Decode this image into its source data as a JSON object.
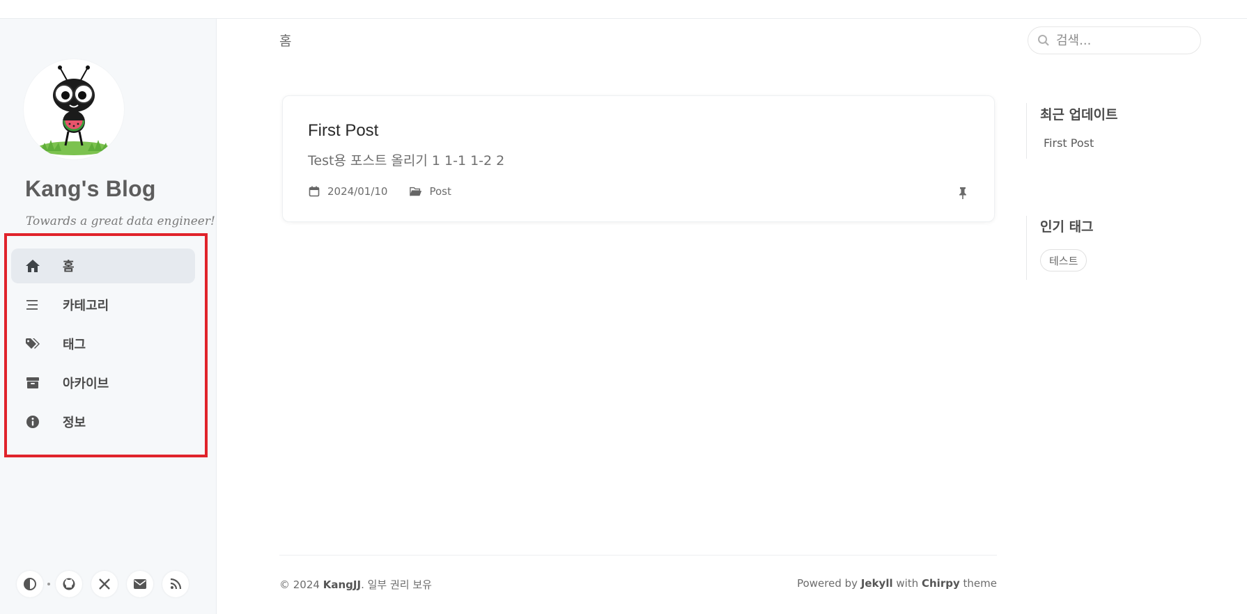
{
  "sidebar": {
    "site_title": "Kang's Blog",
    "site_subtitle": "Towards a great data engineer!",
    "nav": [
      {
        "label": "홈",
        "icon": "home-icon",
        "active": true
      },
      {
        "label": "카테고리",
        "icon": "stream-icon",
        "active": false
      },
      {
        "label": "태그",
        "icon": "tags-icon",
        "active": false
      },
      {
        "label": "아카이브",
        "icon": "archive-icon",
        "active": false
      },
      {
        "label": "정보",
        "icon": "info-circle-icon",
        "active": false
      }
    ],
    "bottom_icons": [
      "theme-toggle-icon",
      "github-icon",
      "x-twitter-icon",
      "email-icon",
      "rss-icon"
    ]
  },
  "header": {
    "breadcrumb": "홈",
    "search_placeholder": "검색..."
  },
  "posts": [
    {
      "title": "First Post",
      "excerpt": "Test용 포스트 올리기 1 1-1 1-2 2",
      "date": "2024/01/10",
      "category": "Post",
      "pinned": true
    }
  ],
  "panel": {
    "recent_title": "최근 업데이트",
    "recent_items": [
      "First Post"
    ],
    "tags_title": "인기 태그",
    "tags": [
      "테스트"
    ]
  },
  "footer": {
    "copyright_prefix": "© 2024",
    "author": "KangJJ",
    "rights": ". 일부 권리 보유",
    "powered_by": "Powered by",
    "engine": "Jekyll",
    "with": "with",
    "theme_name": "Chirpy",
    "theme": "theme"
  },
  "colors": {
    "highlight_frame": "#e0232b",
    "sidebar_bg": "#f6f8fa",
    "active_nav_bg": "#e6eaef"
  }
}
